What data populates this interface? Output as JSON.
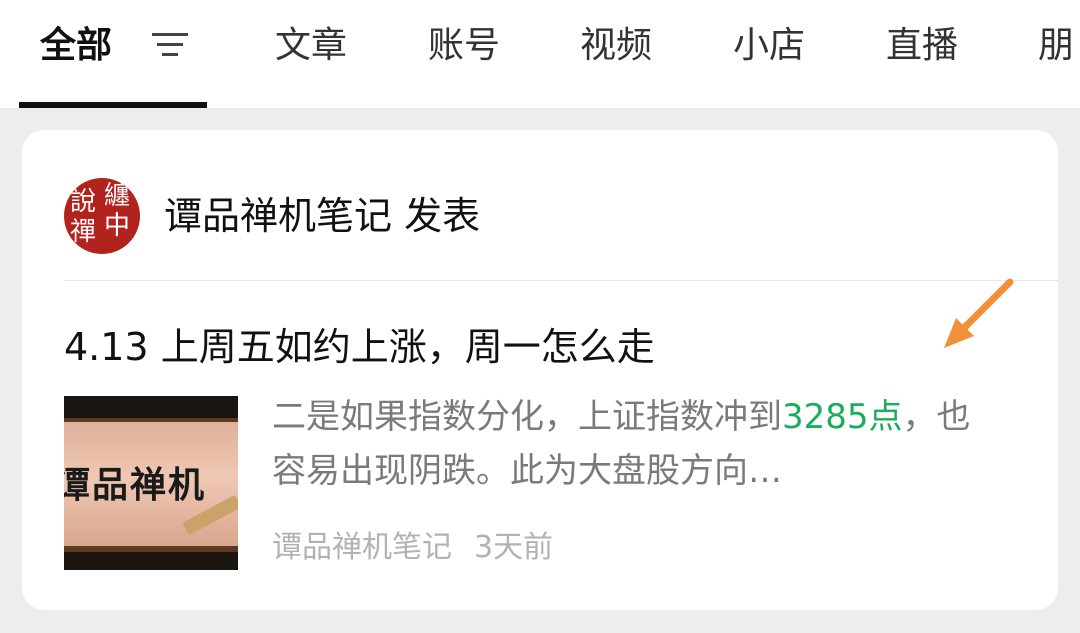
{
  "tabs": {
    "all": "全部",
    "articles": "文章",
    "accounts": "账号",
    "videos": "视频",
    "shops": "小店",
    "live": "直播",
    "moments": "朋"
  },
  "card": {
    "avatar_glyphs": [
      "說",
      "纏",
      "禪",
      "中"
    ],
    "publisher": "谭品禅机笔记 发表",
    "title": "4.13 上周五如约上涨，周一怎么走",
    "thumbnail_text": "谭品禅机",
    "excerpt_before": "二是如果指数分化，上证指数冲到",
    "excerpt_highlight": "3285点",
    "excerpt_after": "，也容易出现阴跌。此为大盘股方向…",
    "source": "谭品禅机笔记",
    "time": "3天前"
  },
  "colors": {
    "highlight": "#1aad5b",
    "arrow": "#f0913a",
    "avatar_bg": "#b3231d"
  }
}
